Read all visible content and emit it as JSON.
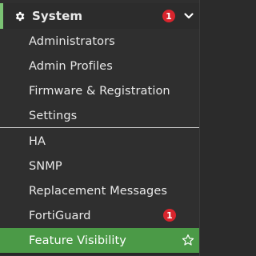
{
  "section": {
    "title": "System",
    "icon": "gear-icon",
    "badge_count": "1",
    "expanded": true
  },
  "items": [
    {
      "label": "Administrators"
    },
    {
      "label": "Admin Profiles"
    },
    {
      "label": "Firmware & Registration"
    },
    {
      "label": "Settings"
    },
    {
      "label": "HA"
    },
    {
      "label": "SNMP"
    },
    {
      "label": "Replacement Messages"
    },
    {
      "label": "FortiGuard",
      "badge": "1"
    },
    {
      "label": "Feature Visibility",
      "active": true,
      "favorite_icon": "star-outline-icon"
    }
  ],
  "colors": {
    "active": "#4b9a47",
    "badge": "#d8252d",
    "accent_border": "#7bc274"
  }
}
